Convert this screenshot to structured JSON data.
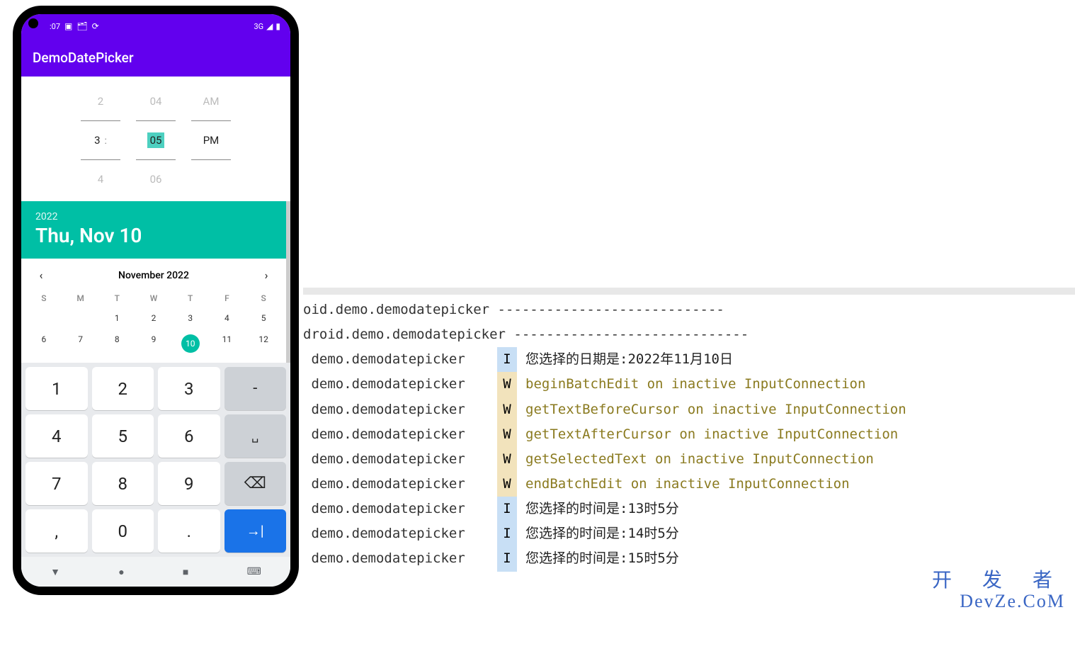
{
  "status": {
    "time": ":07",
    "network": "3G",
    "icons_left": [
      "▣",
      "🗂",
      "⟳"
    ],
    "icons_right": [
      "◢",
      "▮"
    ]
  },
  "app": {
    "title": "DemoDatePicker"
  },
  "time_picker": {
    "hour_prev": "2",
    "hour_sel": "3",
    "hour_next": "4",
    "min_prev": "04",
    "min_sel": "05",
    "min_next": "06",
    "ampm_prev": "AM",
    "ampm_sel": "PM",
    "colon": ":"
  },
  "calendar": {
    "year": "2022",
    "date_label": "Thu, Nov 10",
    "month_label": "November 2022",
    "dow": [
      "S",
      "M",
      "T",
      "W",
      "T",
      "F",
      "S"
    ],
    "offset": 2,
    "selected": 10,
    "max_day": 12
  },
  "keyboard": {
    "r1": [
      "1",
      "2",
      "3",
      "-"
    ],
    "r2": [
      "4",
      "5",
      "6",
      "␣"
    ],
    "r3": [
      "7",
      "8",
      "9",
      "⌫"
    ],
    "r4": [
      ",",
      "0",
      ".",
      "→|"
    ]
  },
  "android_nav": {
    "back": "▼",
    "home": "●",
    "recent": "■",
    "kb": "⌨"
  },
  "log_headers": [
    "oid.demo.demodatepicker ----------------------------",
    "droid.demo.demodatepicker -----------------------------"
  ],
  "log_rows": [
    {
      "pkg": " demo.demodatepicker",
      "lvl": "I",
      "msg": "您选择的日期是:2022年11月10日"
    },
    {
      "pkg": " demo.demodatepicker",
      "lvl": "W",
      "msg": "beginBatchEdit on inactive InputConnection"
    },
    {
      "pkg": " demo.demodatepicker",
      "lvl": "W",
      "msg": "getTextBeforeCursor on inactive InputConnection"
    },
    {
      "pkg": " demo.demodatepicker",
      "lvl": "W",
      "msg": "getTextAfterCursor on inactive InputConnection"
    },
    {
      "pkg": " demo.demodatepicker",
      "lvl": "W",
      "msg": "getSelectedText on inactive InputConnection"
    },
    {
      "pkg": " demo.demodatepicker",
      "lvl": "W",
      "msg": "endBatchEdit on inactive InputConnection"
    },
    {
      "pkg": " demo.demodatepicker",
      "lvl": "I",
      "msg": "您选择的时间是:13时5分"
    },
    {
      "pkg": " demo.demodatepicker",
      "lvl": "I",
      "msg": "您选择的时间是:14时5分"
    },
    {
      "pkg": " demo.demodatepicker",
      "lvl": "I",
      "msg": "您选择的时间是:15时5分"
    }
  ],
  "watermark": {
    "top": "开 发 者",
    "bot": "DevZe.CoM"
  }
}
